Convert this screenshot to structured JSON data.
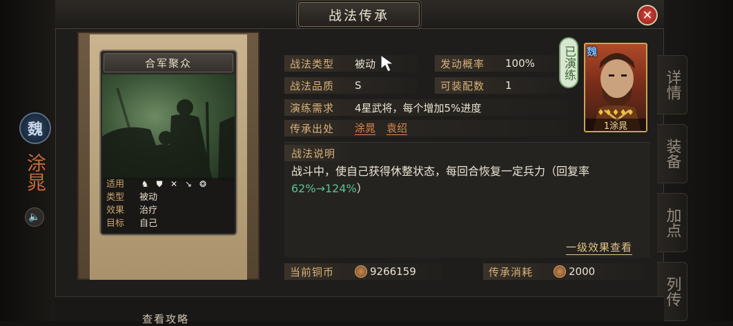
{
  "window": {
    "title": "战法传承",
    "close_label": "✕"
  },
  "left_strip": {
    "kingdom_badge": "魏",
    "hero_name_vertical": "涂晁",
    "sound_icon": "speaker-icon"
  },
  "side_tabs": [
    {
      "label": "详情"
    },
    {
      "label": "装备"
    },
    {
      "label": "加点"
    },
    {
      "label": "列传"
    }
  ],
  "card": {
    "name": "合军聚众",
    "rows": [
      {
        "key": "适用",
        "icons": [
          "cavalry-icon",
          "shield-icon",
          "archer-icon",
          "spear-icon",
          "wheel-icon"
        ]
      },
      {
        "key": "类型",
        "value": "被动"
      },
      {
        "key": "效果",
        "value": "治疗"
      },
      {
        "key": "目标",
        "value": "自己"
      }
    ]
  },
  "details": {
    "type_label": "战法类型",
    "type_value": "被动",
    "rate_label": "发动概率",
    "rate_value": "100%",
    "quality_label": "战法品质",
    "quality_value": "S",
    "equip_label": "可装配数",
    "equip_value": "1",
    "drill_label": "演练需求",
    "drill_value": "4星武将，每个增加5%进度",
    "origin_label": "传承出处",
    "origin_values": [
      "涂晁",
      "袁绍"
    ]
  },
  "description": {
    "label": "战法说明",
    "text_main": "战斗中，使自己获得休整状态，每回合恢复一定兵力（回复率",
    "text_highlight": "62%→124%",
    "text_end": "）",
    "effect_link": "一级效果查看"
  },
  "portrait": {
    "kingdom": "魏",
    "stars": "♦♦♦♦♦",
    "name": "1涂晁",
    "drilled_tag": "已演练"
  },
  "currency": {
    "current_label": "当前铜币",
    "current_value": "9266159",
    "cost_label": "传承消耗",
    "cost_value": "2000"
  },
  "footer": {
    "guide_label": "查看攻略"
  },
  "colors": {
    "accent_gold": "#d7b27a",
    "highlight_green": "#5cc293",
    "link_orange": "#e0874d",
    "close_red": "#c2392f"
  }
}
